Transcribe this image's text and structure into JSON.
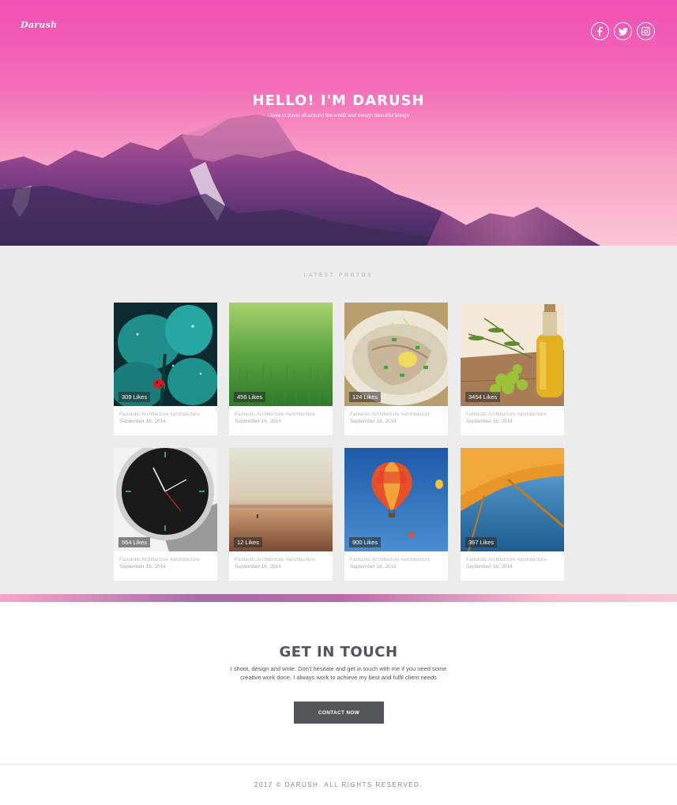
{
  "hero": {
    "logo": "Darush",
    "title": "HELLO! I'M DARUSH",
    "subtitle": "I love to travel all around the world and design beautiful things",
    "social": [
      {
        "name": "facebook-icon"
      },
      {
        "name": "twitter-icon"
      },
      {
        "name": "instagram-icon"
      }
    ]
  },
  "photos": {
    "section_label": "LATEST PHOTOS",
    "cards": [
      {
        "likes": "309 Likes",
        "title": "Fantastic Architecture #architecture",
        "date": "September 16, 2014",
        "image": "clover-ladybug"
      },
      {
        "likes": "456 Likes",
        "title": "Fantastic Architecture #architecture",
        "date": "September 16, 2014",
        "image": "green-grass"
      },
      {
        "likes": "124 Likes",
        "title": "Fantastic Architecture #architecture",
        "date": "September 16, 2014",
        "image": "fish-dish"
      },
      {
        "likes": "3454 Likes",
        "title": "Fantastic Architecture #architecture",
        "date": "September 16, 2014",
        "image": "olive-oil"
      },
      {
        "likes": "564 Likes",
        "title": "Fantastic Architecture #architecture",
        "date": "September 16, 2014",
        "image": "smartwatch"
      },
      {
        "likes": "12 Likes",
        "title": "Fantastic Architecture #architecture",
        "date": "September 16, 2014",
        "image": "beach-sunset"
      },
      {
        "likes": "900 Likes",
        "title": "Fantastic Architecture #architecture",
        "date": "September 16, 2014",
        "image": "hot-air-balloon"
      },
      {
        "likes": "367 Likes",
        "title": "Fantastic Architecture #architecture",
        "date": "September 16, 2014",
        "image": "plane-wing-sea"
      }
    ]
  },
  "contact": {
    "title": "GET IN TOUCH",
    "text": "I shoot, design and write. Don't hesitate and get in touch with me if you need some creative work done. I always work to achieve my best and fulfil client needs",
    "button": "CONTACT NOW"
  },
  "footer": {
    "copyright": "2017 © DARUSH. ALL RIGHTS RESERVED."
  }
}
